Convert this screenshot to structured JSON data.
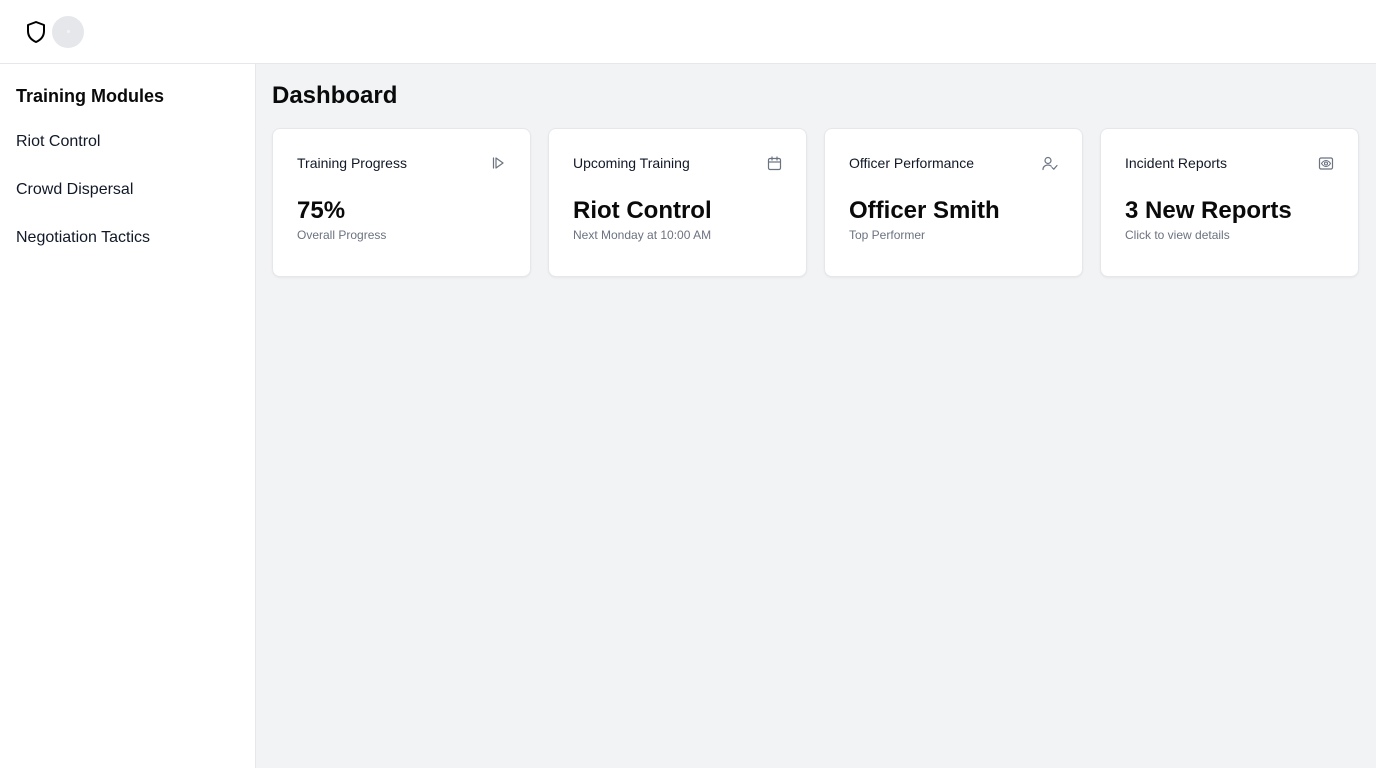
{
  "header": {
    "logo_icon": "shield-icon",
    "avatar_icon": "user-avatar"
  },
  "sidebar": {
    "title": "Training Modules",
    "items": [
      {
        "label": "Riot Control"
      },
      {
        "label": "Crowd Dispersal"
      },
      {
        "label": "Negotiation Tactics"
      }
    ]
  },
  "main": {
    "title": "Dashboard",
    "cards": [
      {
        "title": "Training Progress",
        "icon": "play-icon",
        "value": "75%",
        "subtitle": "Overall Progress"
      },
      {
        "title": "Upcoming Training",
        "icon": "calendar-icon",
        "value": "Riot Control",
        "subtitle": "Next Monday at 10:00 AM"
      },
      {
        "title": "Officer Performance",
        "icon": "user-check-icon",
        "value": "Officer Smith",
        "subtitle": "Top Performer"
      },
      {
        "title": "Incident Reports",
        "icon": "report-eye-icon",
        "value": "3 New Reports",
        "subtitle": "Click to view details"
      }
    ]
  },
  "colors": {
    "accent": "#0a0a0a",
    "muted_text": "#6b7280",
    "main_background": "#f2f3f5",
    "border": "#e5e7eb"
  }
}
